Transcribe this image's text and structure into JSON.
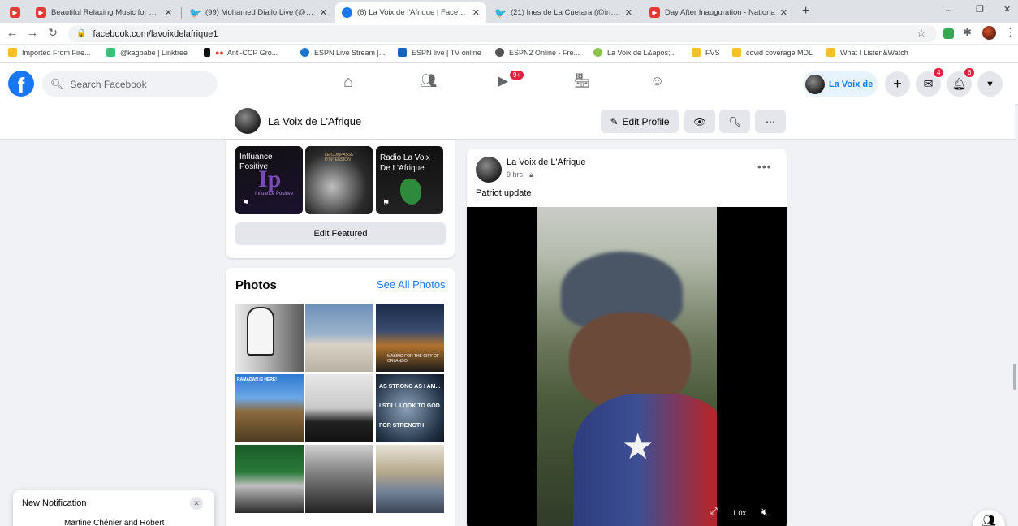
{
  "browser": {
    "tabs": [
      {
        "title": "",
        "icon": "youtube-icon"
      },
      {
        "title": "Beautiful Relaxing Music for Stre",
        "icon": "youtube-icon"
      },
      {
        "title": "(99) Mohamed Diallo Live (@Mo",
        "icon": "twitter-icon"
      },
      {
        "title": "(6) La Voix de l'Afrique | Faceboo",
        "icon": "facebook-icon"
      },
      {
        "title": "(21) Ines de La Cuetara (@inesd",
        "icon": "twitter-icon"
      },
      {
        "title": "Day After Inauguration - Nationa",
        "icon": "youtube-icon"
      }
    ],
    "close_glyph": "✕",
    "new_tab_glyph": "+",
    "url": "facebook.com/lavoixdelafrique1",
    "window_controls": {
      "minimize": "–",
      "restore": "❐",
      "close": "✕"
    },
    "bookmarks": [
      {
        "label": "Imported From Fire...",
        "color": "#f6bf26"
      },
      {
        "label": "@kagbabe | Linktree",
        "color": "#39c37a"
      },
      {
        "label": "Anti-CCP Gro...",
        "color": "#e53935"
      },
      {
        "label": "ESPN Live Stream |...",
        "color": "#1976d2"
      },
      {
        "label": "ESPN live | TV online",
        "color": "#1565c0"
      },
      {
        "label": "ESPN2 Online - Fre...",
        "color": "#555555"
      },
      {
        "label": "La Voix de L&apos;...",
        "color": "#8bc34a"
      },
      {
        "label": "FVS",
        "color": "#f6bf26"
      },
      {
        "label": "covid coverage MDL",
        "color": "#f6bf26"
      },
      {
        "label": "What I Listen&Watch",
        "color": "#f6bf26"
      }
    ]
  },
  "facebook": {
    "search_placeholder": "Search Facebook",
    "watch_badge": "9+",
    "profile_chip_label": "La Voix de",
    "messenger_badge": "4",
    "notifications_badge": "6",
    "brand_color": "#1877f2"
  },
  "page": {
    "name": "La Voix de L'Afrique",
    "edit_profile_label": "Edit Profile",
    "featured": [
      {
        "title": "Influance Positive",
        "caption": "Influance Positive"
      },
      {
        "title": "LE COMPASSE D'INTENSION",
        "caption": ""
      },
      {
        "title": "Radio La Voix De L'Afrique",
        "caption": ""
      }
    ],
    "edit_featured_label": "Edit Featured",
    "photos_title": "Photos",
    "see_all_photos_label": "See All Photos",
    "photo_captions": [
      "",
      "",
      "MAKING FOR THE CITY OF ORLANDO",
      "RAMADAN IS HERE!",
      "",
      "AS STRONG AS I AM... I STILL LOOK TO GOD FOR STRENGTH",
      "",
      "",
      ""
    ]
  },
  "post": {
    "author": "La Voix de L'Afrique",
    "time": "9 hrs",
    "privacy_icon": "lock-icon",
    "text": "Patriot update",
    "playback_speed": "1.0x"
  },
  "notification": {
    "title": "New Notification",
    "body": "Martine Chénier and Robert"
  }
}
